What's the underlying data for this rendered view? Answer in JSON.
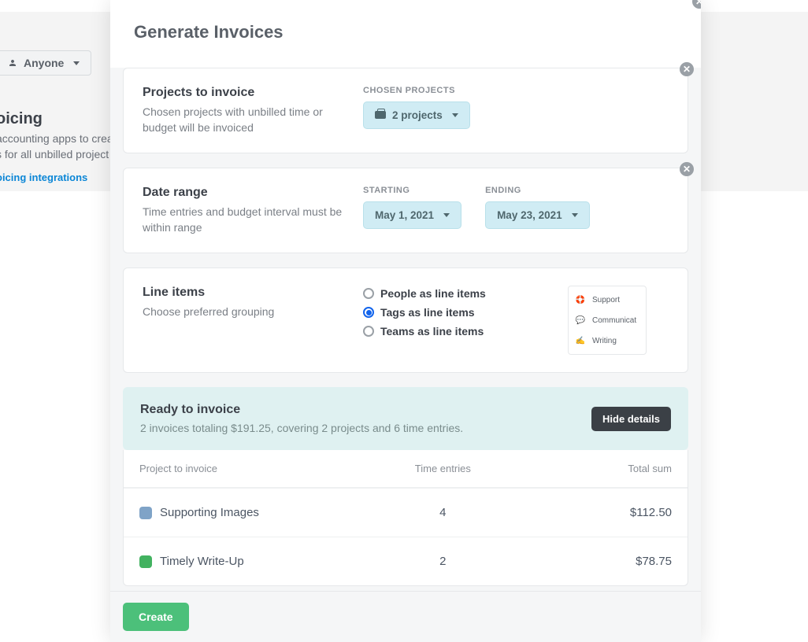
{
  "background": {
    "anyone": "Anyone",
    "heading": "oicing",
    "desc1": "accounting apps to crea",
    "desc2": "s for all unbilled project",
    "link": "oicing integrations"
  },
  "modal": {
    "title": "Generate Invoices",
    "projects": {
      "title": "Projects to invoice",
      "desc": "Chosen projects with unbilled time or budget will be invoiced",
      "chosen_label": "CHOSEN PROJECTS",
      "chip": "2 projects"
    },
    "dates": {
      "title": "Date range",
      "desc": "Time entries and budget interval must be within range",
      "start_label": "STARTING",
      "start_value": "May 1, 2021",
      "end_label": "ENDING",
      "end_value": "May 23, 2021"
    },
    "lineitems": {
      "title": "Line items",
      "desc": "Choose preferred grouping",
      "options": {
        "people": "People as line items",
        "tags": "Tags as line items",
        "teams": "Teams as line items"
      },
      "preview": {
        "support": "Support",
        "comm": "Communicat",
        "writing": "Writing"
      }
    },
    "ready": {
      "title": "Ready to invoice",
      "summary": "2 invoices totaling $191.25, covering 2 projects and 6 time entries.",
      "hide": "Hide details"
    },
    "table": {
      "h1": "Project to invoice",
      "h2": "Time entries",
      "h3": "Total  sum",
      "rows": [
        {
          "name": "Supporting Images",
          "entries": "4",
          "total": "$112.50",
          "color": "#7fa3c7"
        },
        {
          "name": "Timely Write-Up",
          "entries": "2",
          "total": "$78.75",
          "color": "#42b260"
        }
      ]
    },
    "create": "Create"
  }
}
